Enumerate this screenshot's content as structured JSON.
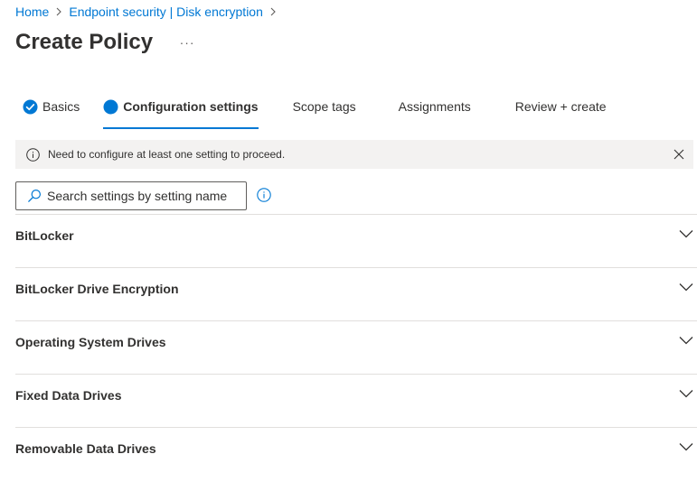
{
  "breadcrumb": {
    "items": [
      "Home",
      "Endpoint security | Disk encryption"
    ]
  },
  "header": {
    "title": "Create Policy",
    "more_label": "···"
  },
  "tabs": [
    {
      "label": "Basics",
      "state": "completed"
    },
    {
      "label": "Configuration settings",
      "state": "active"
    },
    {
      "label": "Scope tags",
      "state": "pending"
    },
    {
      "label": "Assignments",
      "state": "pending"
    },
    {
      "label": "Review + create",
      "state": "pending"
    }
  ],
  "notice": {
    "message": "Need to configure at least one setting to proceed.",
    "icon": "info-icon",
    "dismiss_icon": "close-icon"
  },
  "search": {
    "placeholder": "Search settings by setting name",
    "value": ""
  },
  "sections": [
    {
      "label": "BitLocker",
      "expanded": false
    },
    {
      "label": "BitLocker Drive Encryption",
      "expanded": false
    },
    {
      "label": "Operating System Drives",
      "expanded": false
    },
    {
      "label": "Fixed Data Drives",
      "expanded": false
    },
    {
      "label": "Removable Data Drives",
      "expanded": false
    }
  ],
  "colors": {
    "accent": "#0078d4",
    "text": "#323130",
    "notice_bg": "#f3f2f1",
    "divider": "#e1dfdd"
  }
}
